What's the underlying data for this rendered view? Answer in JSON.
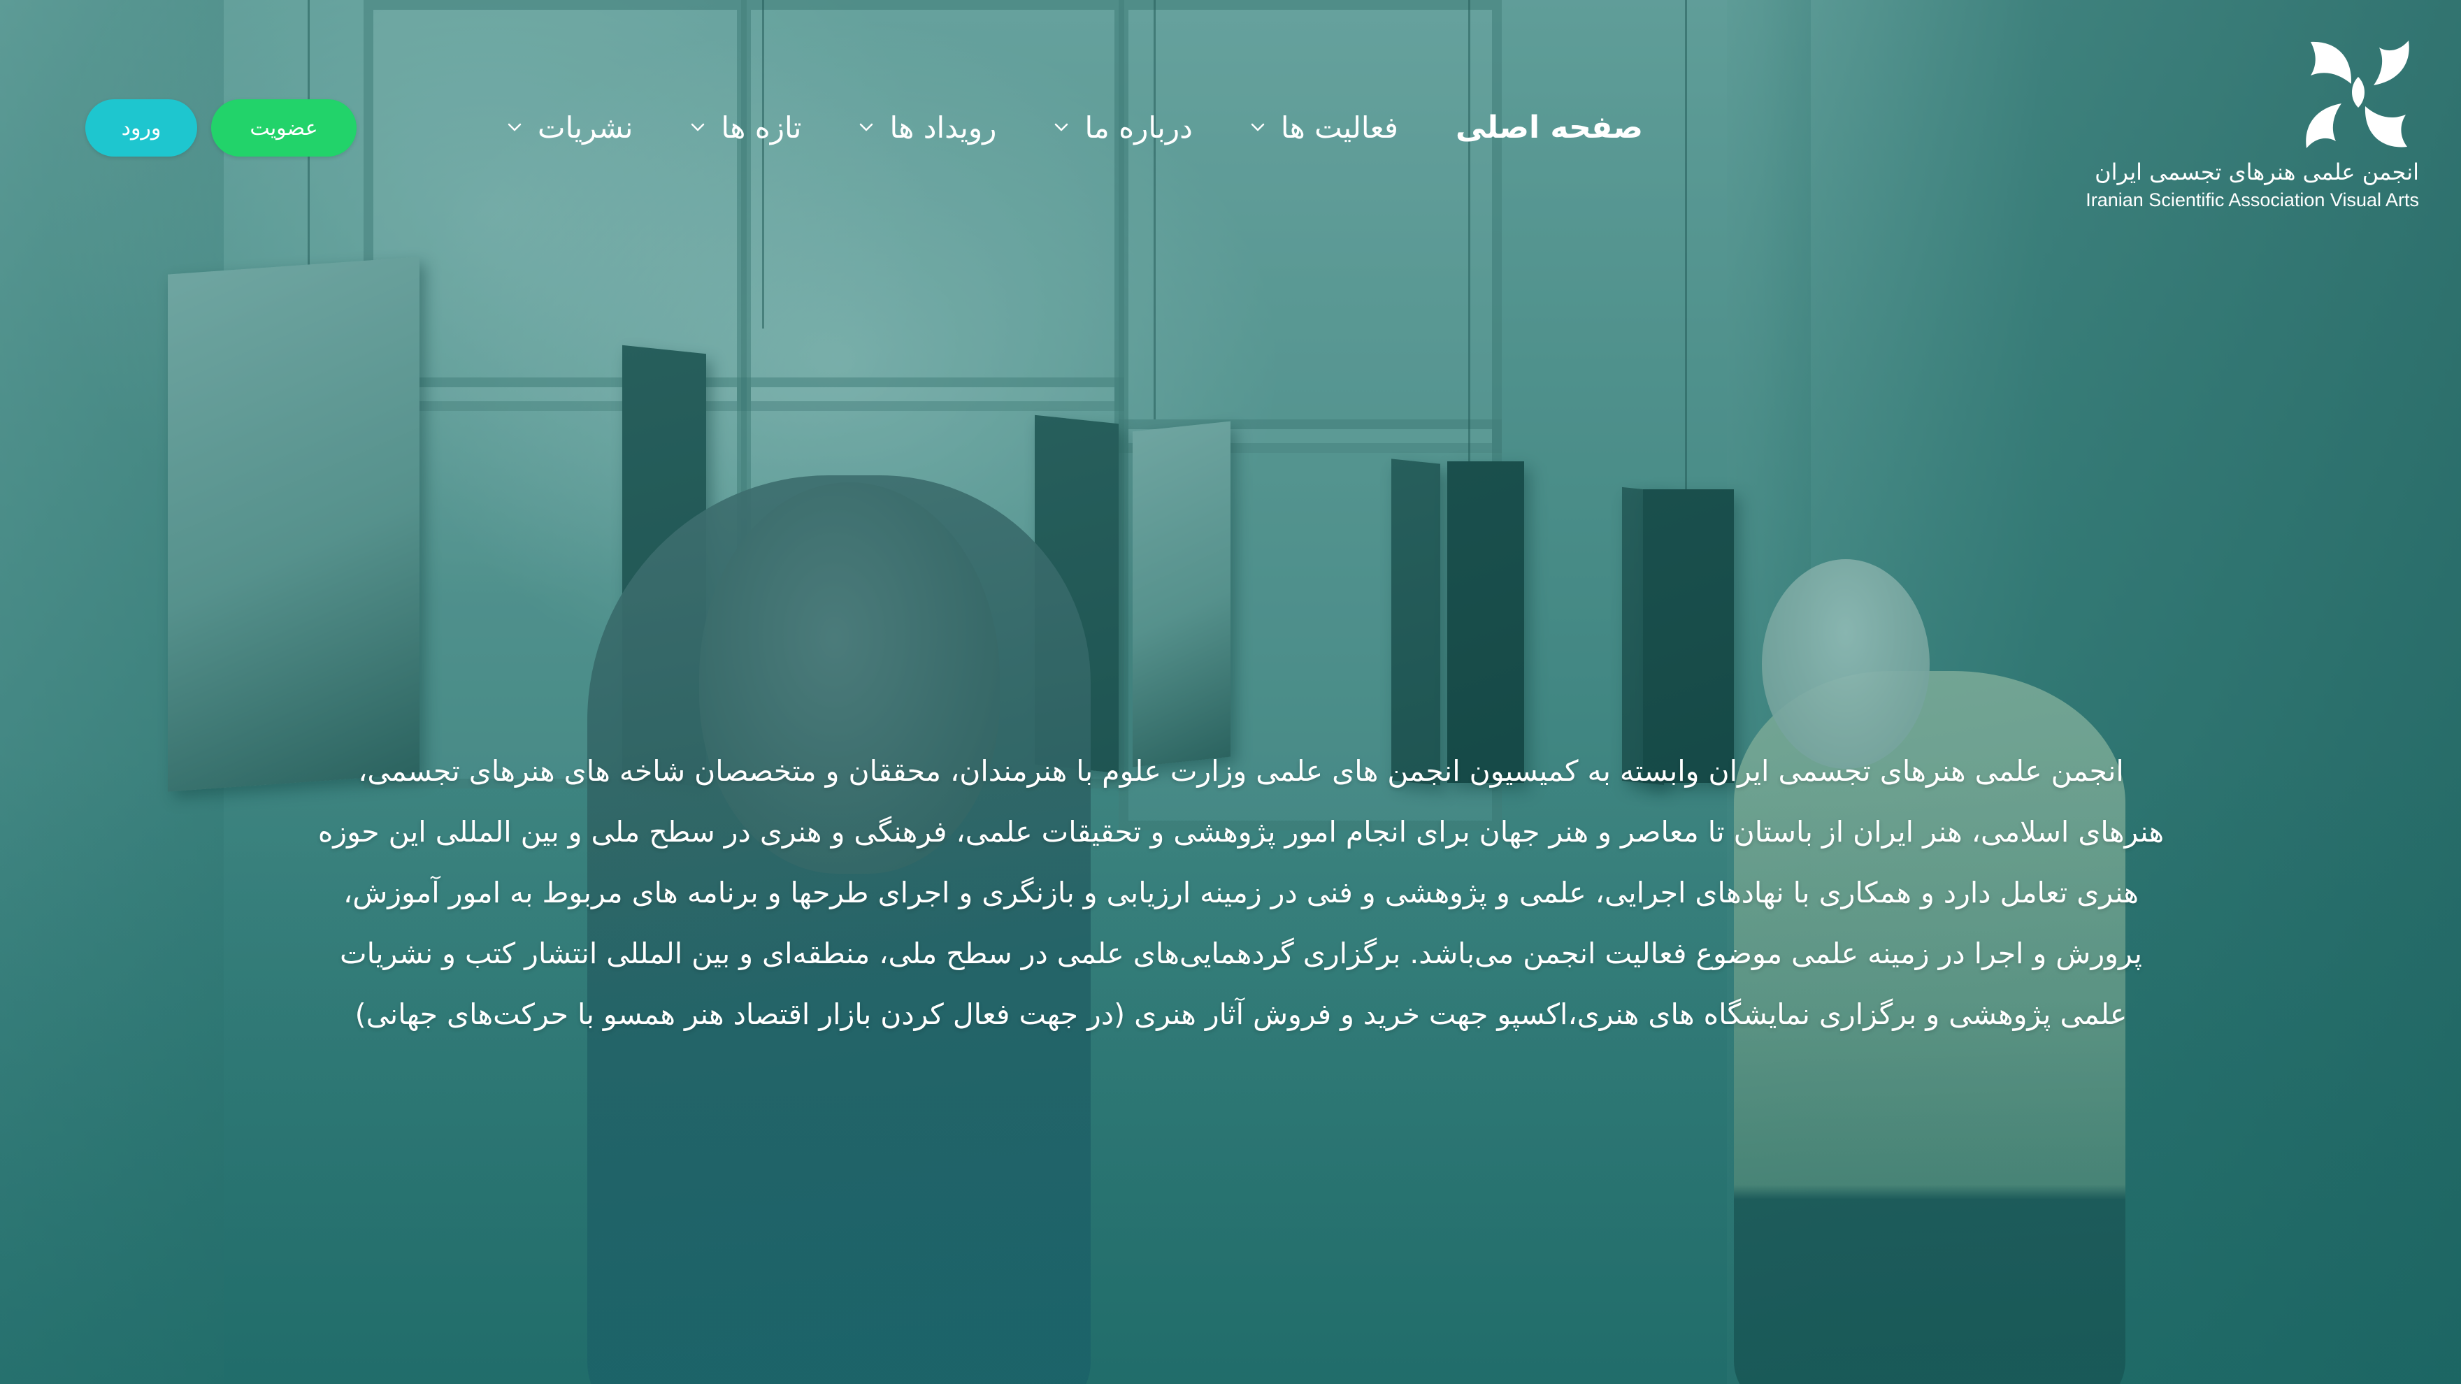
{
  "brand": {
    "name_fa": "انجمن علمی هنرهای تجسمی ایران",
    "name_en": "Iranian Scientific Association Visual Arts",
    "logo_icon": "association-logo-icon"
  },
  "nav": {
    "home": "صفحه اصلی",
    "activities": "فعالیت ها",
    "about": "درباره ما",
    "events": "رویداد ها",
    "news": "تازه ها",
    "publications": "نشریات",
    "dropdown_icon": "chevron-down-icon"
  },
  "auth": {
    "join_label": "عضویت",
    "login_label": "ورود"
  },
  "intro": {
    "lines": [
      "انجمن علمی هنرهای تجسمی ایران وابسته به کمیسیون انجمن های علمی وزارت علوم با هنرمندان، محققان و متخصصان شاخه های هنرهای تجسمی،",
      "هنرهای اسلامی، هنر ایران از باستان تا معاصر و هنر جهان برای انجام امور پژوهشی و تحقیقات علمی، فرهنگی و هنری در سطح ملی و بین المللی این حوزه",
      "هنری تعامل دارد و همکاری با نهادهای اجرایی، علمی و پژوهشی و فنی در زمینه ارزیابی و بازنگری و اجرای طرحها و برنامه های مربوط به امور آموزش،",
      "پرورش و اجرا در زمینه علمی موضوع فعالیت انجمن می‌باشد. برگزاری گردهمایی‌های علمی در سطح ملی، منطقه‌ای و بین المللی انتشار کتب و نشریات",
      "علمی پژوهشی و برگزاری نمایشگاه های هنری،اکسپو جهت خرید و فروش آثار هنری (در جهت فعال کردن بازار اقتصاد هنر همسو با حرکت‌های جهانی)"
    ]
  },
  "colors": {
    "overlay": "#1f7d78",
    "login_button": "#1ec6cf",
    "join_button": "#22d36a",
    "text": "#ffffff"
  }
}
